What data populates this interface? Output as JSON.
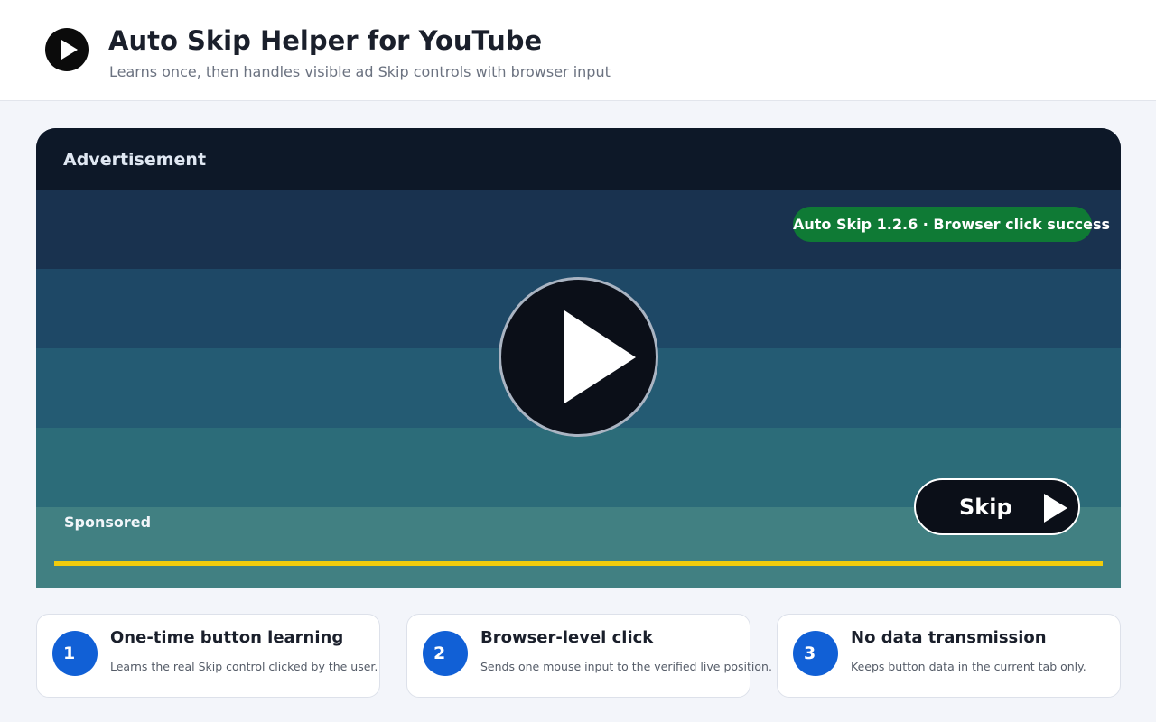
{
  "header": {
    "title": "Auto Skip Helper for YouTube",
    "subtitle": "Learns once, then handles visible ad Skip controls with browser input",
    "logo_icon": "play-circle-icon"
  },
  "player": {
    "ad_label": "Advertisement",
    "status": "Auto Skip 1.2.6 · Browser click success",
    "play_icon": "play-icon",
    "skip_label": "Skip",
    "skip_icon": "skip-icon",
    "sponsored_label": "Sponsored",
    "progress_fraction": 1.0,
    "colors": {
      "status_pill": "#0f7a35",
      "progress": "#f2cc0c",
      "header_bar": "#0d1828"
    }
  },
  "features": [
    {
      "number": "1",
      "title": "One-time button learning",
      "description": "Learns the real Skip control clicked by the user."
    },
    {
      "number": "2",
      "title": "Browser-level click",
      "description": "Sends one mouse input to the verified live position."
    },
    {
      "number": "3",
      "title": "No data transmission",
      "description": "Keeps button data in the current tab only."
    }
  ],
  "colors": {
    "accent": "#1160d6",
    "page_background": "#f3f5fa"
  }
}
